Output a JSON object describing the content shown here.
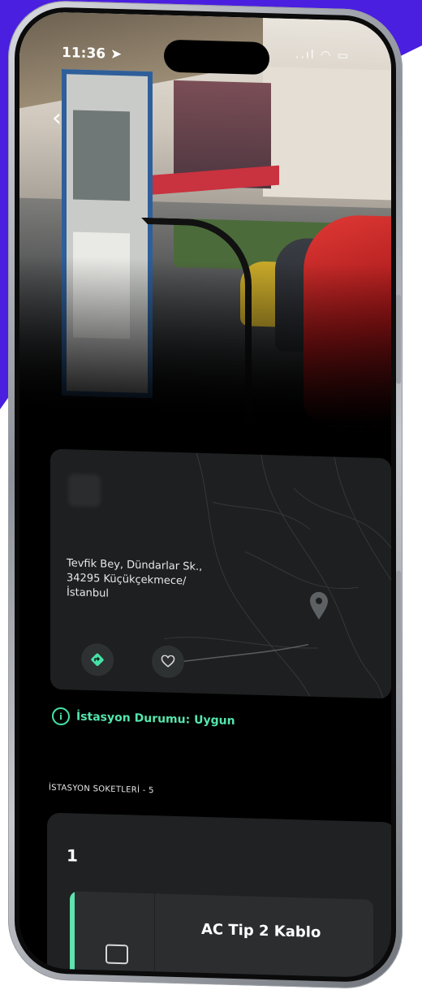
{
  "status_bar": {
    "time": "11:36 ➤",
    "icons": "..ıl ◠ ▭"
  },
  "nav": {
    "back_symbol": "‹"
  },
  "address": {
    "lines": [
      "Tevfik Bey, Dündarlar Sk.,",
      "34295 Küçükçekmece/",
      "İstanbul"
    ]
  },
  "actions": {
    "directions_icon": "directions-icon",
    "favorite_icon": "heart-icon"
  },
  "station_status": {
    "icon": "i",
    "text": "İstasyon Durumu: Uygun"
  },
  "sockets": {
    "section_title": "İSTASYON SOKETLERİ - 5",
    "items": [
      {
        "number": "1",
        "name": "AC Tip 2 Kablo"
      }
    ]
  },
  "colors": {
    "accent": "#55e6ad",
    "background_purple": "#4a1fe0",
    "card": "#1d1f20"
  }
}
